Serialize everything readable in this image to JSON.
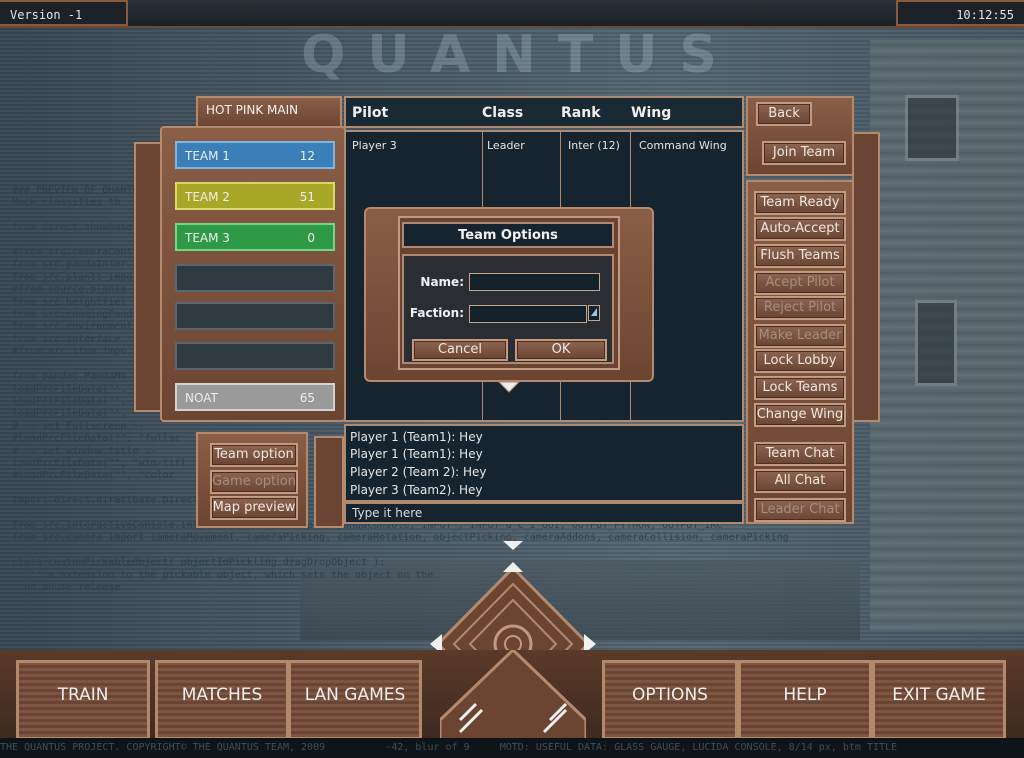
{
  "version_label": "Version -1",
  "clock": "10:12:55",
  "logo_text": "QUANTUS",
  "team_panel_title": "HOT PINK MAIN",
  "teams": [
    {
      "name": "TEAM 1",
      "count": "12",
      "color": "#3a7fb8"
    },
    {
      "name": "TEAM 2",
      "count": "51",
      "color": "#a9a728"
    },
    {
      "name": "TEAM 3",
      "count": "0",
      "color": "#2f9a45"
    },
    {
      "name": "",
      "count": ""
    },
    {
      "name": "",
      "count": ""
    },
    {
      "name": "",
      "count": ""
    },
    {
      "name": "NOAT",
      "count": "65",
      "color": "#9a9a9a"
    }
  ],
  "table": {
    "headers": {
      "pilot": "Pilot",
      "class": "Class",
      "rank": "Rank",
      "wing": "Wing"
    },
    "rows": [
      {
        "pilot": "Player 3",
        "class": "Leader",
        "rank": "Inter (12)",
        "wing": "Command Wing"
      }
    ]
  },
  "left_buttons": {
    "team_option": "Team option",
    "game_option": "Game option",
    "map_preview": "Map preview"
  },
  "right_buttons": {
    "back": "Back",
    "join_team": "Join Team",
    "team_ready": "Team Ready",
    "auto_accept": "Auto-Accept",
    "flush_teams": "Flush Teams",
    "accept_pilot": "Acept Pilot",
    "reject_pilot": "Reject Pilot",
    "make_leader": "Make Leader",
    "lock_lobby": "Lock Lobby",
    "lock_teams": "Lock Teams",
    "change_wing": "Change Wing",
    "team_chat": "Team Chat",
    "all_chat": "All Chat",
    "leader_chat": "Leader Chat"
  },
  "chat": {
    "messages": [
      "Player 1 (Team1): Hey",
      "Player 1 (Team1): Hey",
      "Player 2 (Team 2): Hey",
      "Player 3 (Team2). Hey"
    ],
    "input_placeholder": "Type it here"
  },
  "dialog": {
    "title": "Team Options",
    "name_label": "Name:",
    "faction_label": "Faction:",
    "cancel": "Cancel",
    "ok": "OK"
  },
  "nav": {
    "train": "TRAIN",
    "matches": "MATCHES",
    "lan_games": "LAN GAMES",
    "options": "OPTIONS",
    "help": "HELP",
    "exit_game": "EXIT GAME"
  },
  "footer_text": "THE QUANTUS PROJECT. COPYRIGHT© THE QUANTUS TEAM, 2009          -42, blur of 9     MOTD: USEFUL DATA: GLASS GAUGE, LUCIDA CONSOLE, 8/14 px, btm TITLE",
  "code_text": "### PREVIEW OF QUANTUS\nMock classifies th\n\nfrom direct.showbase\n\n#from src.cameraCont\nfrom src.pandaInter\nfrom src.plants impo\n#from source.planta\nfrom src.heightfiel\nfrom src.roamingPand\nfrom src.environment\nfrom src.interface\n#from src.item impo\n\nfrom pandac.PandaMo\nloadPrcFileData(\"\",\nloadPrcFileData(\"\",\nloadPrcFileData(\"\", \"\n# -- set Fullscreen --\n#loadPrcFileData(\"\", \"fullsc\n# -- set window title --\nloadPrcFileData(\"\", \"win-titl\n#loadPrcFileData(\"\", \"color\n\nimport direct.directbase.Direct\n\nfrom src.interactiveConsole.interactiveConsole import pandaConsole, INPUT_, INPUT_G_C_I_GUI, OUTPUT_PYTHON, OUTPUT_IRC\nfrom src.camera import cameraMovement, cameraPicking, cameraRotation, objectPicking, cameraAddons, cameraCollision, cameraPicking\n\nclass customPickableObject( objectIdPickling.dragDropObject ):\n  ''' a extension to the pickable object, which sets the object on the\n  on mouse release"
}
